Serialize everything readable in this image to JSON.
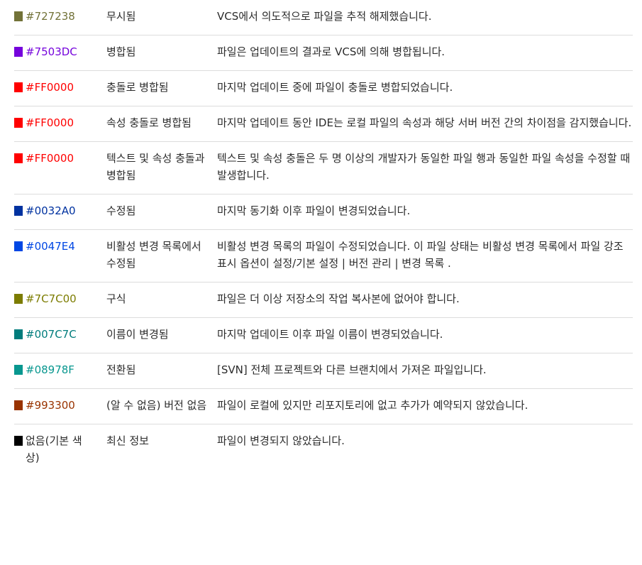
{
  "rows": [
    {
      "color_label": "#727238",
      "swatch": "#727238",
      "text_color": "#727238",
      "status": "무시됨",
      "description": "VCS에서 의도적으로 파일을 추적 해제했습니다."
    },
    {
      "color_label": "#7503DC",
      "swatch": "#7503DC",
      "text_color": "#7503DC",
      "status": "병합됨",
      "description": "파일은 업데이트의 결과로 VCS에 의해 병합됩니다."
    },
    {
      "color_label": "#FF0000",
      "swatch": "#FF0000",
      "text_color": "#FF0000",
      "status": "충돌로 병합됨",
      "description": "마지막 업데이트 중에 파일이 충돌로 병합되었습니다."
    },
    {
      "color_label": "#FF0000",
      "swatch": "#FF0000",
      "text_color": "#FF0000",
      "status": "속성 충돌로 병합됨",
      "description": "마지막 업데이트 동안 IDE는 로컬 파일의 속성과 해당 서버 버전 간의 차이점을 감지했습니다."
    },
    {
      "color_label": "#FF0000",
      "swatch": "#FF0000",
      "text_color": "#FF0000",
      "status": "텍스트 및 속성 충돌과 병합됨",
      "description": "텍스트 및 속성 충돌은 두 명 이상의 개발자가 동일한 파일 행과 동일한 파일 속성을 수정할 때 발생합니다."
    },
    {
      "color_label": "#0032A0",
      "swatch": "#0032A0",
      "text_color": "#0032A0",
      "status": "수정됨",
      "description": "마지막 동기화 이후 파일이 변경되었습니다."
    },
    {
      "color_label": "#0047E4",
      "swatch": "#0047E4",
      "text_color": "#0047E4",
      "status": "비활성 변경 목록에서 수정됨",
      "description": "비활성 변경 목록의 파일이 수정되었습니다. 이 파일 상태는 비활성 변경 목록에서 파일 강조 표시 옵션이 설정/기본 설정 | 버전 관리 | 변경 목록 ."
    },
    {
      "color_label": "#7C7C00",
      "swatch": "#7C7C00",
      "text_color": "#7C7C00",
      "status": "구식",
      "description": "파일은 더 이상 저장소의 작업 복사본에 없어야 합니다."
    },
    {
      "color_label": "#007C7C",
      "swatch": "#007C7C",
      "text_color": "#007C7C",
      "status": "이름이 변경됨",
      "description": "마지막 업데이트 이후 파일 이름이 변경되었습니다."
    },
    {
      "color_label": "#08978F",
      "swatch": "#08978F",
      "text_color": "#08978F",
      "status": "전환됨",
      "description": "[SVN] 전체 프로젝트와 다른 브랜치에서 가져온 파일입니다."
    },
    {
      "color_label": "#993300",
      "swatch": "#993300",
      "text_color": "#993300",
      "status": "(알 수 없음) 버전 없음",
      "description": "파일이 로컬에 있지만 리포지토리에 없고 추가가 예약되지 않았습니다."
    },
    {
      "color_label": "없음(기본 색상)",
      "swatch": "#000000",
      "text_color": "#2b2b2b",
      "status": "최신 정보",
      "description": "파일이 변경되지 않았습니다."
    }
  ]
}
